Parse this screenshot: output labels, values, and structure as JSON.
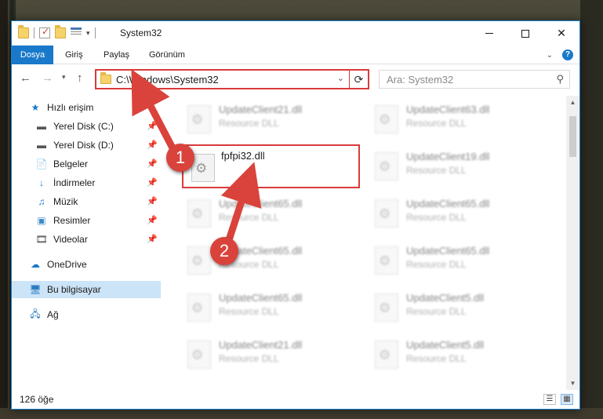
{
  "window": {
    "title": "System32"
  },
  "ribbon": {
    "tabs": [
      "Dosya",
      "Giriş",
      "Paylaş",
      "Görünüm"
    ],
    "expand_icon": "chevron-down-icon",
    "help_icon": "help-icon"
  },
  "navigation": {
    "address": "C:\\Windows\\System32",
    "search_placeholder": "Ara: System32"
  },
  "sidebar": {
    "items": [
      {
        "label": "Hızlı erişim",
        "icon": "star-icon",
        "pinned": false
      },
      {
        "label": "Yerel Disk (C:)",
        "icon": "drive-icon",
        "pinned": true
      },
      {
        "label": "Yerel Disk (D:)",
        "icon": "drive-icon",
        "pinned": true
      },
      {
        "label": "Belgeler",
        "icon": "documents-icon",
        "pinned": true
      },
      {
        "label": "İndirmeler",
        "icon": "download-icon",
        "pinned": true
      },
      {
        "label": "Müzik",
        "icon": "music-icon",
        "pinned": true
      },
      {
        "label": "Resimler",
        "icon": "pictures-icon",
        "pinned": true
      },
      {
        "label": "Videolar",
        "icon": "video-icon",
        "pinned": true
      },
      {
        "label": "OneDrive",
        "icon": "cloud-icon",
        "pinned": false
      },
      {
        "label": "Bu bilgisayar",
        "icon": "computer-icon",
        "pinned": false,
        "selected": true
      },
      {
        "label": "Ağ",
        "icon": "network-icon",
        "pinned": false
      }
    ]
  },
  "files": [
    {
      "name": "UpdateClient21.dll",
      "type": "Resource DLL"
    },
    {
      "name": "UpdateClient63.dll",
      "type": "Resource DLL"
    },
    {
      "name": "fpfpi32.dll",
      "type": ""
    },
    {
      "name": "UpdateClient19.dll",
      "type": "Resource DLL"
    },
    {
      "name": "UpdateClient65.dll",
      "type": "Resource DLL"
    },
    {
      "name": "UpdateClient65.dll",
      "type": "Resource DLL"
    },
    {
      "name": "UpdateClient65.dll",
      "type": "Resource DLL"
    },
    {
      "name": "UpdateClient65.dll",
      "type": "Resource DLL"
    },
    {
      "name": "UpdateClient65.dll",
      "type": "Resource DLL"
    },
    {
      "name": "UpdateClient5.dll",
      "type": "Resource DLL"
    },
    {
      "name": "UpdateClient21.dll",
      "type": "Resource DLL"
    },
    {
      "name": "UpdateClient5.dll",
      "type": "Resource DLL"
    }
  ],
  "status": {
    "item_count": "126 öğe"
  },
  "annotations": {
    "step1": "1",
    "step2": "2",
    "color": "#d9433b"
  }
}
